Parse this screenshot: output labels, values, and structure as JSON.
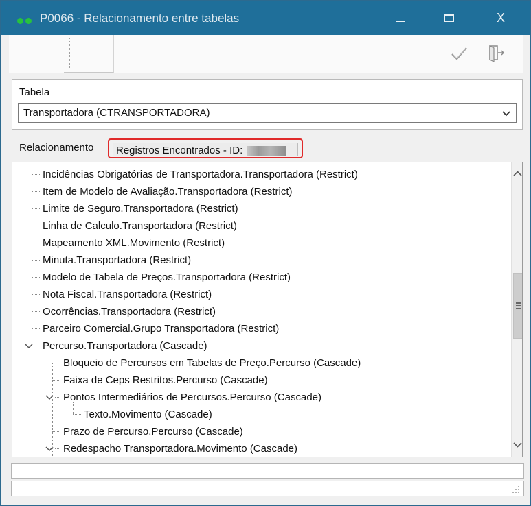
{
  "window": {
    "title": "P0066 - Relacionamento entre tabelas",
    "controls": {
      "minimize": "minimize",
      "maximize": "maximize",
      "close": "X"
    }
  },
  "toolbar": {
    "confirm_icon": "check-icon",
    "exit_icon": "exit-door-icon"
  },
  "tabela": {
    "label": "Tabela",
    "selected": "Transportadora (CTRANSPORTADORA)"
  },
  "tabs": {
    "relacionamento": "Relacionamento",
    "registros": "Registros Encontrados - ID: "
  },
  "tree": {
    "items": [
      {
        "label": "Incidências Obrigatórias de Transportadora.Transportadora (Restrict)",
        "level": 1
      },
      {
        "label": "Item de Modelo de Avaliação.Transportadora (Restrict)",
        "level": 1
      },
      {
        "label": "Limite de Seguro.Transportadora (Restrict)",
        "level": 1
      },
      {
        "label": "Linha de Calculo.Transportadora (Restrict)",
        "level": 1
      },
      {
        "label": "Mapeamento XML.Movimento (Restrict)",
        "level": 1
      },
      {
        "label": "Minuta.Transportadora (Restrict)",
        "level": 1
      },
      {
        "label": "Modelo de Tabela de Preços.Transportadora (Restrict)",
        "level": 1
      },
      {
        "label": "Nota Fiscal.Transportadora (Restrict)",
        "level": 1
      },
      {
        "label": "Ocorrências.Transportadora (Restrict)",
        "level": 1
      },
      {
        "label": "Parceiro Comercial.Grupo Transportadora (Restrict)",
        "level": 1
      },
      {
        "label": "Percurso.Transportadora (Cascade)",
        "level": 1,
        "expanded": true
      },
      {
        "label": "Bloqueio de Percursos em Tabelas de Preço.Percurso (Cascade)",
        "level": 2
      },
      {
        "label": "Faixa de Ceps Restritos.Percurso (Cascade)",
        "level": 2
      },
      {
        "label": "Pontos Intermediários de Percursos.Percurso (Cascade)",
        "level": 2,
        "expanded": true
      },
      {
        "label": "Texto.Movimento (Cascade)",
        "level": 3
      },
      {
        "label": "Prazo de Percurso.Percurso (Cascade)",
        "level": 2
      },
      {
        "label": "Redespacho Transportadora.Movimento (Cascade)",
        "level": 2,
        "expanded": true
      }
    ]
  },
  "scrollbar": {
    "position": 0.45
  }
}
